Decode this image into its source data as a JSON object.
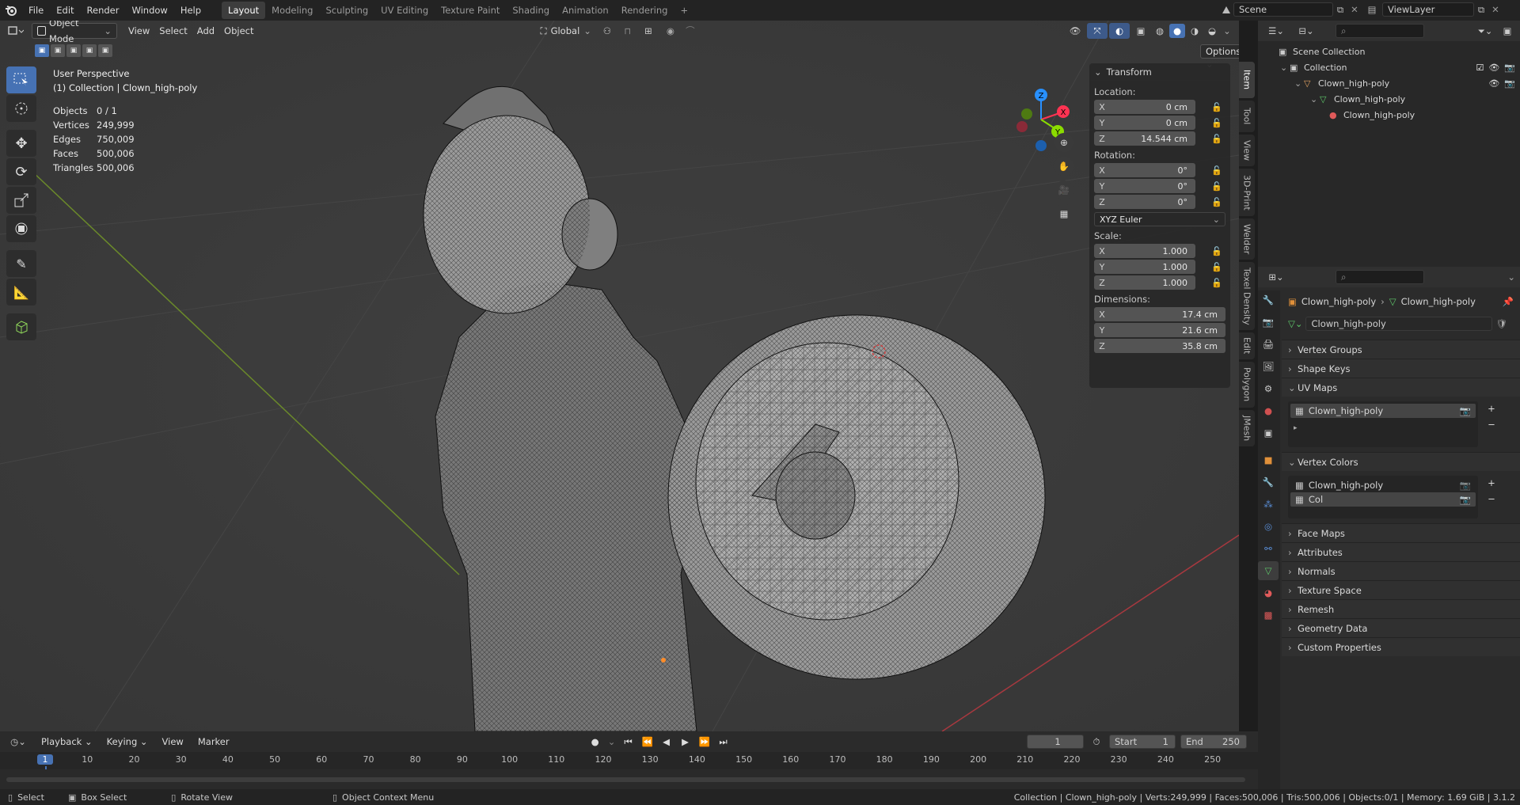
{
  "top_menu": [
    "File",
    "Edit",
    "Render",
    "Window",
    "Help"
  ],
  "workspaces": [
    {
      "label": "Layout",
      "active": true
    },
    {
      "label": "Modeling"
    },
    {
      "label": "Sculpting"
    },
    {
      "label": "UV Editing"
    },
    {
      "label": "Texture Paint"
    },
    {
      "label": "Shading"
    },
    {
      "label": "Animation"
    },
    {
      "label": "Rendering"
    }
  ],
  "scene_name": "Scene",
  "viewlayer_name": "ViewLayer",
  "viewport": {
    "mode": "Object Mode",
    "menus": [
      "View",
      "Select",
      "Add",
      "Object"
    ],
    "orientation": "Global",
    "options_label": "Options",
    "overlay_title": "User Perspective",
    "overlay_subtitle": "(1) Collection | Clown_high-poly",
    "stats": [
      {
        "k": "Objects",
        "v": "0 / 1"
      },
      {
        "k": "Vertices",
        "v": "249,999"
      },
      {
        "k": "Edges",
        "v": "750,009"
      },
      {
        "k": "Faces",
        "v": "500,006"
      },
      {
        "k": "Triangles",
        "v": "500,006"
      }
    ],
    "gizmo": {
      "x": "X",
      "y": "Y",
      "z": "Z"
    }
  },
  "transform": {
    "title": "Transform",
    "location_label": "Location:",
    "location": [
      {
        "ax": "X",
        "v": "0 cm"
      },
      {
        "ax": "Y",
        "v": "0 cm"
      },
      {
        "ax": "Z",
        "v": "14.544 cm"
      }
    ],
    "rotation_label": "Rotation:",
    "rotation": [
      {
        "ax": "X",
        "v": "0°"
      },
      {
        "ax": "Y",
        "v": "0°"
      },
      {
        "ax": "Z",
        "v": "0°"
      }
    ],
    "rotation_mode": "XYZ Euler",
    "scale_label": "Scale:",
    "scale": [
      {
        "ax": "X",
        "v": "1.000"
      },
      {
        "ax": "Y",
        "v": "1.000"
      },
      {
        "ax": "Z",
        "v": "1.000"
      }
    ],
    "dimensions_label": "Dimensions:",
    "dimensions": [
      {
        "ax": "X",
        "v": "17.4 cm"
      },
      {
        "ax": "Y",
        "v": "21.6 cm"
      },
      {
        "ax": "Z",
        "v": "35.8 cm"
      }
    ]
  },
  "side_tabs": [
    "Item",
    "Tool",
    "View",
    "3D-Print",
    "Welder",
    "Texel Density",
    "Edit",
    "Polygon",
    "JMesh"
  ],
  "outliner": {
    "rows": [
      {
        "label": "Scene Collection",
        "indent": 0
      },
      {
        "label": "Collection",
        "indent": 1
      },
      {
        "label": "Clown_high-poly",
        "indent": 2
      },
      {
        "label": "Clown_high-poly",
        "indent": 3
      },
      {
        "label": "Clown_high-poly",
        "indent": 4
      }
    ]
  },
  "properties": {
    "breadcrumb_obj": "Clown_high-poly",
    "breadcrumb_data": "Clown_high-poly",
    "mesh_name": "Clown_high-poly",
    "panels": {
      "vertex_groups": "Vertex Groups",
      "shape_keys": "Shape Keys",
      "uv_maps": "UV Maps",
      "vertex_colors": "Vertex Colors",
      "face_maps": "Face Maps",
      "attributes": "Attributes",
      "normals": "Normals",
      "texture_space": "Texture Space",
      "remesh": "Remesh",
      "geometry_data": "Geometry Data",
      "custom_properties": "Custom Properties"
    },
    "uv_items": [
      "Clown_high-poly"
    ],
    "vc_items": [
      "Clown_high-poly",
      "Col"
    ]
  },
  "timeline": {
    "menus": [
      "Playback",
      "Keying",
      "View",
      "Marker"
    ],
    "current_frame": "1",
    "start_label": "Start",
    "start": "1",
    "end_label": "End",
    "end": "250",
    "ticks": [
      "1",
      "10",
      "20",
      "30",
      "40",
      "50",
      "60",
      "70",
      "80",
      "90",
      "100",
      "110",
      "120",
      "130",
      "140",
      "150",
      "160",
      "170",
      "180",
      "190",
      "200",
      "210",
      "220",
      "230",
      "240",
      "250"
    ]
  },
  "status": {
    "select": "Select",
    "box_select": "Box Select",
    "rotate_view": "Rotate View",
    "context_menu": "Object Context Menu",
    "info": "Collection | Clown_high-poly | Verts:249,999 | Faces:500,006 | Tris:500,006 | Objects:0/1 | Memory: 1.69 GiB | 3.1.2"
  },
  "colors": {
    "accent": "#4772b3",
    "x_axis": "#ff3352",
    "y_axis": "#8bdc00",
    "z_axis": "#2890ff"
  }
}
